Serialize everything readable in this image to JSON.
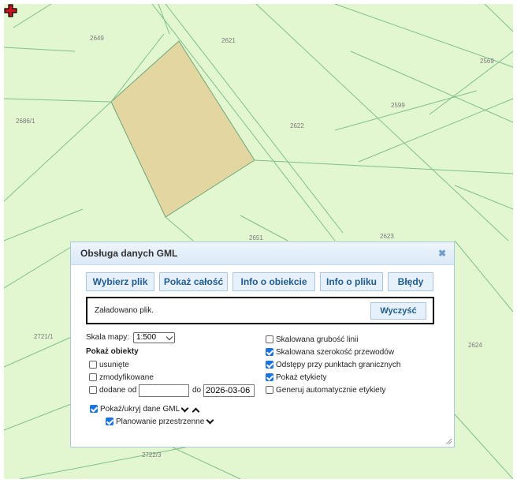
{
  "map": {
    "parcel_numbers": [
      "2649",
      "2621",
      "2569",
      "2599",
      "2686/1",
      "2622",
      "2651",
      "2623",
      "2721/1",
      "2624",
      "2722/3"
    ],
    "highlight_color": "#e3d6a0",
    "background_color": "#e2f7cf",
    "cursor_icon": "crosshair-marker-icon"
  },
  "panel": {
    "title": "Obsługa danych GML",
    "close_icon": "close-icon",
    "buttons": [
      "Wybierz plik",
      "Pokaż całość",
      "Info o obiekcie",
      "Info o pliku",
      "Błędy"
    ],
    "status_text": "Załadowano plik.",
    "clear_label": "Wyczyść",
    "scale_label": "Skala mapy:",
    "scale_value": "1:500",
    "show_objects_heading": "Pokaż obiekty",
    "removed_label": "usunięte",
    "modified_label": "zmodyfikowane",
    "added_from_label": "dodane od",
    "added_from_value": "",
    "to_label": "do",
    "to_value": "2026-03-06",
    "right_options": [
      {
        "label": "Skalowana grubość linii",
        "checked": false
      },
      {
        "label": "Skalowana szerokość przewodów",
        "checked": true
      },
      {
        "label": "Odstępy przy punktach granicznych",
        "checked": true
      },
      {
        "label": "Pokaż etykiety",
        "checked": true
      },
      {
        "label": "Generuj automatycznie etykiety",
        "checked": false
      }
    ],
    "toggle_gml_label": "Pokaż/ukryj dane GML",
    "planning_label": "Planowanie przestrzenne"
  }
}
